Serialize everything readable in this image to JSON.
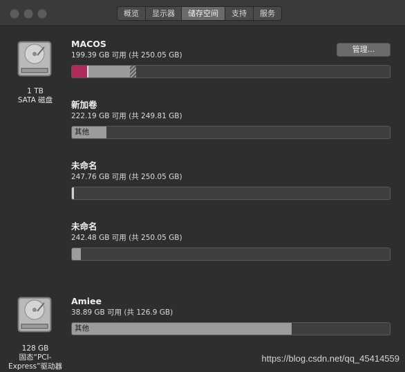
{
  "tabs": [
    {
      "label": "概览"
    },
    {
      "label": "显示器"
    },
    {
      "label": "储存空间",
      "active": true
    },
    {
      "label": "支持"
    },
    {
      "label": "服务"
    }
  ],
  "drives": [
    {
      "line1": "1 TB",
      "line2": "SATA 磁盘",
      "line3": ""
    },
    {
      "line1": "128 GB",
      "line2": "固态“PCI-",
      "line3": "Express”驱动器"
    }
  ],
  "manage_label": "管理...",
  "volumes": [
    {
      "name": "MACOS",
      "capacity": "199.39 GB 可用 (共 250.05 GB)",
      "segment_label": ""
    },
    {
      "name": "新加卷",
      "capacity": "222.19 GB 可用 (共 249.81 GB)",
      "segment_label": "其他"
    },
    {
      "name": "未命名",
      "capacity": "247.76 GB 可用 (共 250.05 GB)",
      "segment_label": ""
    },
    {
      "name": "未命名",
      "capacity": "242.48 GB 可用 (共 250.05 GB)",
      "segment_label": ""
    },
    {
      "name": "Amiee",
      "capacity": "38.89 GB 可用 (共 126.9 GB)",
      "segment_label": "其他"
    }
  ],
  "bar_fractions": [
    {
      "pink": 0.05,
      "light": 0.13,
      "hatch": 0.02
    },
    {
      "gray": 0.11
    },
    {
      "gray": 0.01
    },
    {
      "gray": 0.03
    },
    {
      "gray": 0.69
    }
  ],
  "colors": {
    "system_pink": "#b0295a",
    "used_light": "#9a9a9a",
    "other_gray": "#9c9c9c",
    "bar_bg": "#3e3e3e"
  },
  "watermark": "https://blog.csdn.net/qq_45414559"
}
